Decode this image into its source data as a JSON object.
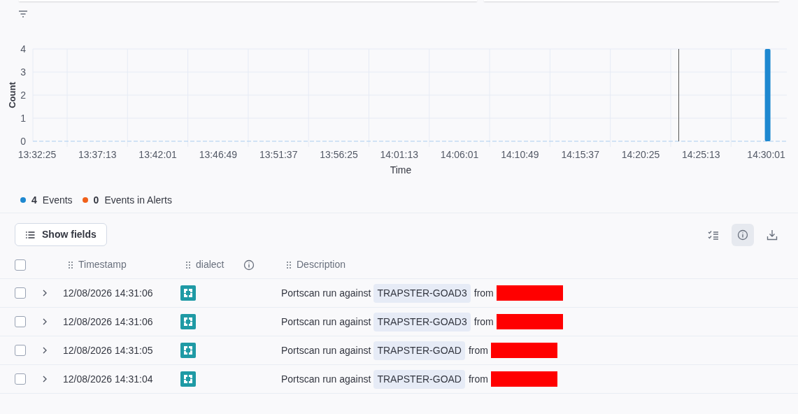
{
  "chart": {
    "chart_data": {
      "type": "bar",
      "xlabel": "Time",
      "ylabel": "Count",
      "grid": true,
      "categories": [
        "13:32:25",
        "13:37:13",
        "13:42:01",
        "13:46:49",
        "13:51:37",
        "13:56:25",
        "14:01:13",
        "14:06:01",
        "14:10:49",
        "14:15:37",
        "14:20:25",
        "14:25:13",
        "14:30:01"
      ],
      "series": [
        {
          "name": "Events",
          "color": "#1e88d0",
          "values": [
            0,
            0,
            0,
            0,
            0,
            0,
            0,
            0,
            0,
            0,
            0,
            0,
            4
          ]
        },
        {
          "name": "Events in Alerts",
          "color": "#f0601a",
          "values": [
            0,
            0,
            0,
            0,
            0,
            0,
            0,
            0,
            0,
            0,
            0,
            0,
            0
          ]
        }
      ],
      "ylim": [
        0,
        4
      ],
      "yticks": [
        0,
        1,
        2,
        3,
        4
      ]
    },
    "legend_counts": [
      "4",
      "0"
    ]
  },
  "toolbar": {
    "show_fields": "Show fields"
  },
  "table": {
    "all_checked": false,
    "columns": [
      {
        "label": "Timestamp",
        "info": false
      },
      {
        "label": "dialect",
        "info": true
      },
      {
        "label": "Description",
        "info": false
      }
    ],
    "rows": [
      {
        "checked": false,
        "timestamp": "12/08/2026 14:31:06",
        "description": "Portscan run against",
        "host": "TRAPSTER-GOAD3",
        "from": "from"
      },
      {
        "checked": false,
        "timestamp": "12/08/2026 14:31:06",
        "description": "Portscan run against",
        "host": "TRAPSTER-GOAD3",
        "from": "from"
      },
      {
        "checked": false,
        "timestamp": "12/08/2026 14:31:05",
        "description": "Portscan run against",
        "host": "TRAPSTER-GOAD",
        "from": "from"
      },
      {
        "checked": false,
        "timestamp": "12/08/2026 14:31:04",
        "description": "Portscan run against",
        "host": "TRAPSTER-GOAD",
        "from": "from"
      }
    ]
  }
}
